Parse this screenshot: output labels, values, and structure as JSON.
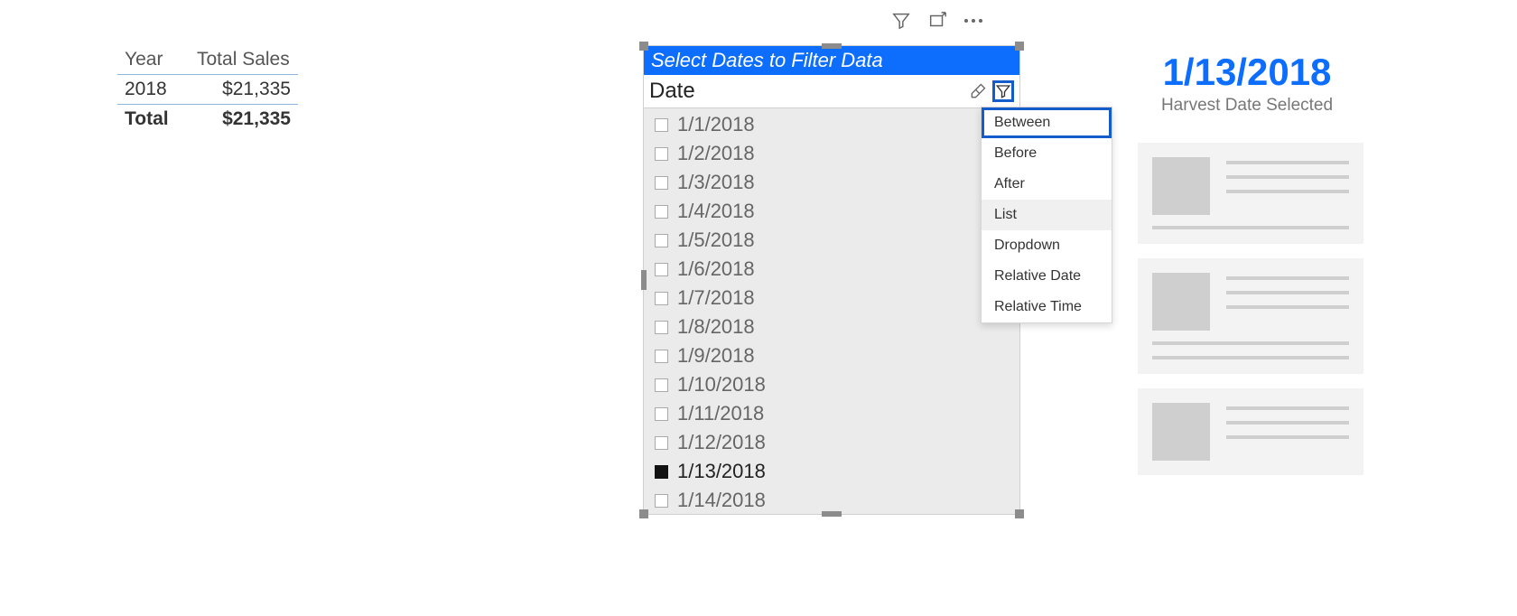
{
  "matrix": {
    "headers": [
      "Year",
      "Total Sales"
    ],
    "rows": [
      {
        "year": "2018",
        "value": "$21,335"
      }
    ],
    "total_label": "Total",
    "total_value": "$21,335"
  },
  "slicer": {
    "title": "Select Dates to Filter Data",
    "field": "Date",
    "items": [
      {
        "label": "1/1/2018",
        "selected": false
      },
      {
        "label": "1/2/2018",
        "selected": false
      },
      {
        "label": "1/3/2018",
        "selected": false
      },
      {
        "label": "1/4/2018",
        "selected": false
      },
      {
        "label": "1/5/2018",
        "selected": false
      },
      {
        "label": "1/6/2018",
        "selected": false
      },
      {
        "label": "1/7/2018",
        "selected": false
      },
      {
        "label": "1/8/2018",
        "selected": false
      },
      {
        "label": "1/9/2018",
        "selected": false
      },
      {
        "label": "1/10/2018",
        "selected": false
      },
      {
        "label": "1/11/2018",
        "selected": false
      },
      {
        "label": "1/12/2018",
        "selected": false
      },
      {
        "label": "1/13/2018",
        "selected": true
      },
      {
        "label": "1/14/2018",
        "selected": false
      }
    ],
    "menu": [
      {
        "label": "Between",
        "highlight": true,
        "active": false
      },
      {
        "label": "Before",
        "highlight": false,
        "active": false
      },
      {
        "label": "After",
        "highlight": false,
        "active": false
      },
      {
        "label": "List",
        "highlight": false,
        "active": true
      },
      {
        "label": "Dropdown",
        "highlight": false,
        "active": false
      },
      {
        "label": "Relative Date",
        "highlight": false,
        "active": false
      },
      {
        "label": "Relative Time",
        "highlight": false,
        "active": false
      }
    ]
  },
  "card": {
    "value": "1/13/2018",
    "label": "Harvest Date Selected"
  }
}
